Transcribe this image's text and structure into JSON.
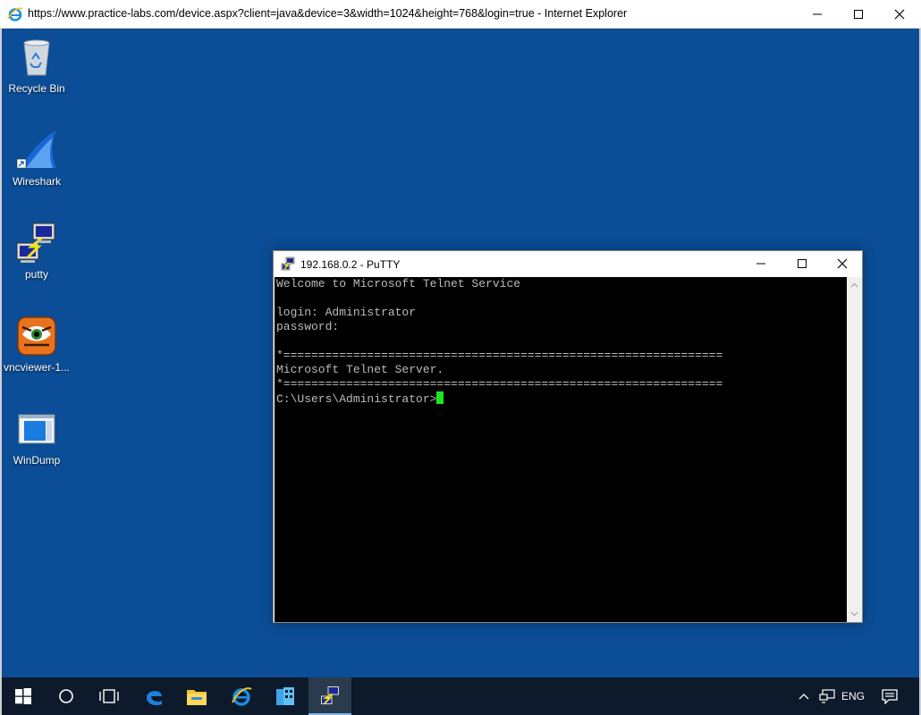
{
  "browser": {
    "title": "https://www.practice-labs.com/device.aspx?client=java&device=3&width=1024&height=768&login=true - Internet Explorer"
  },
  "desktop_icons": [
    {
      "label": "Recycle Bin",
      "icon": "recycle-bin-icon"
    },
    {
      "label": "Wireshark",
      "icon": "wireshark-icon"
    },
    {
      "label": "putty",
      "icon": "putty-icon"
    },
    {
      "label": "vncviewer-1...",
      "icon": "vncviewer-icon"
    },
    {
      "label": "WinDump",
      "icon": "windump-icon"
    }
  ],
  "putty": {
    "title": "192.168.0.2 - PuTTY",
    "lines": [
      "Welcome to Microsoft Telnet Service",
      "",
      "login: Administrator",
      "password:",
      "",
      "*===============================================================",
      "Microsoft Telnet Server.",
      "*===============================================================",
      "C:\\Users\\Administrator>"
    ],
    "cursor_color": "#1ee61e"
  },
  "taskbar": {
    "items": [
      "start-icon",
      "search-icon",
      "task-view-icon",
      "edge-icon",
      "file-explorer-icon",
      "internet-explorer-icon",
      "server-manager-icon",
      "putty-icon"
    ],
    "active_item": "putty-icon",
    "language": "ENG"
  },
  "colors": {
    "desktop": "#0b4d96",
    "taskbar": "#0c1a2b",
    "terminal_bg": "#000000",
    "terminal_fg": "#bbbbbb"
  }
}
